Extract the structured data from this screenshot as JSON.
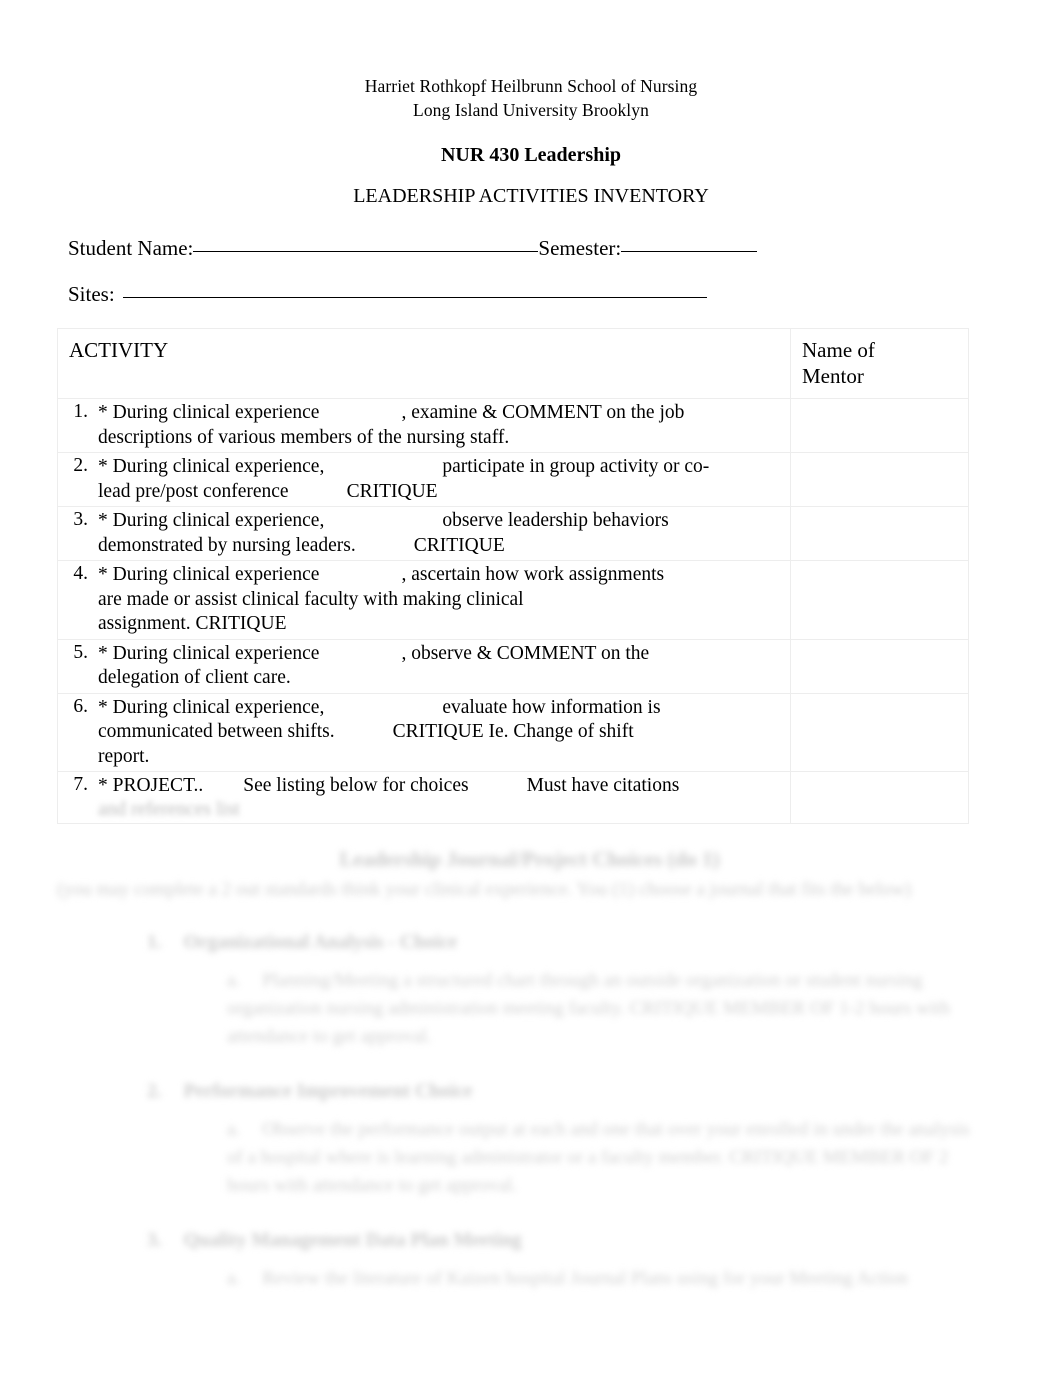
{
  "document": {
    "header": {
      "school_line_1": "Harriet Rothkopf Heilbrunn School of Nursing",
      "school_line_2": "Long Island University Brooklyn",
      "course_title": "NUR 430 Leadership",
      "document_title": "LEADERSHIP ACTIVITIES INVENTORY"
    },
    "form": {
      "student_name_label": "Student Name:",
      "student_name_value": "",
      "semester_label": "Semester:",
      "semester_value": "",
      "sites_label": "Sites:",
      "sites_value": ""
    },
    "table": {
      "columns": [
        {
          "id": "activity",
          "label": "ACTIVITY"
        },
        {
          "id": "mentor",
          "label": "Name of Mentor",
          "label_line_1": "Name of",
          "label_line_2": "Mentor"
        }
      ],
      "rows": [
        {
          "number": "1.",
          "lines": [
            {
              "segments": [
                "* During clinical experience",
                "GAP_MD",
                ", examine & COMMENT on the job"
              ]
            },
            {
              "segments": [
                "descriptions of various members of the nursing staff."
              ]
            }
          ],
          "mentor": ""
        },
        {
          "number": "2.",
          "lines": [
            {
              "segments": [
                "* During clinical experience,",
                "GAP_LG",
                "participate in group activity or co-"
              ]
            },
            {
              "segments": [
                "lead pre/post conference",
                "GAP_SM",
                "CRITIQUE"
              ]
            }
          ],
          "mentor": ""
        },
        {
          "number": "3.",
          "lines": [
            {
              "segments": [
                "* During clinical experience,",
                "GAP_LG",
                "observe leadership behaviors"
              ]
            },
            {
              "segments": [
                "demonstrated by nursing leaders.",
                "GAP_SM",
                "CRITIQUE"
              ]
            }
          ],
          "mentor": ""
        },
        {
          "number": "4.",
          "lines": [
            {
              "segments": [
                "* During clinical experience",
                "GAP_MD",
                ", ascertain how work assignments"
              ]
            },
            {
              "segments": [
                "are made or assist clinical faculty with making clinical"
              ]
            },
            {
              "segments": [
                "assignment. CRITIQUE"
              ]
            }
          ],
          "mentor": ""
        },
        {
          "number": "5.",
          "lines": [
            {
              "segments": [
                "* During clinical experience",
                "GAP_MD",
                ", observe & COMMENT on the"
              ]
            },
            {
              "segments": [
                "delegation of client care."
              ]
            }
          ],
          "mentor": ""
        },
        {
          "number": "6.",
          "lines": [
            {
              "segments": [
                "* During clinical experience,",
                "GAP_LG",
                "evaluate how information is"
              ]
            },
            {
              "segments": [
                "communicated between shifts.",
                "GAP_SM",
                "CRITIQUE Ie. Change of shift"
              ]
            },
            {
              "segments": [
                "report."
              ]
            }
          ],
          "mentor": ""
        },
        {
          "number": "7.",
          "lines": [
            {
              "segments": [
                "* PROJECT..",
                "GAP_XS",
                "See listing below for choices",
                "GAP_SM",
                "Must have citations"
              ]
            }
          ],
          "trailing_faded": "and references list",
          "mentor": ""
        }
      ]
    },
    "blurred_section": {
      "note": "illegible-blurred",
      "heading": "Leadership Journal/Project Choices (do 1)",
      "intro": "(you may complete a 2 out standards think your clinical experience. You (1) choose a journal that fits the below)",
      "items": [
        {
          "marker": "1.",
          "label": "Organizational Analysis - Choice",
          "sub_marker": "a.",
          "sub_text": "Planning/Meeting a structured chart through an outside organization or student nursing organization nursing administration meeting faculty. CRITIQUE MEMBER OF 1-2 hours with attendance to get approval."
        },
        {
          "marker": "2.",
          "label": "Performance Improvement Choice",
          "sub_marker": "a.",
          "sub_text": "Observe the performance output at each and one that over your enrolled in under the analysis of a hospital where is learning administrator or a faculty member. CRITIQUE MEMBER OF 2 hours with attendance to get approval."
        },
        {
          "marker": "3.",
          "label": "Quality Management Data Plan Meeting",
          "sub_marker": "a.",
          "sub_text": "Review the literature of Kaizen hospital Journal Plans using for your Meeting Action"
        }
      ]
    }
  }
}
